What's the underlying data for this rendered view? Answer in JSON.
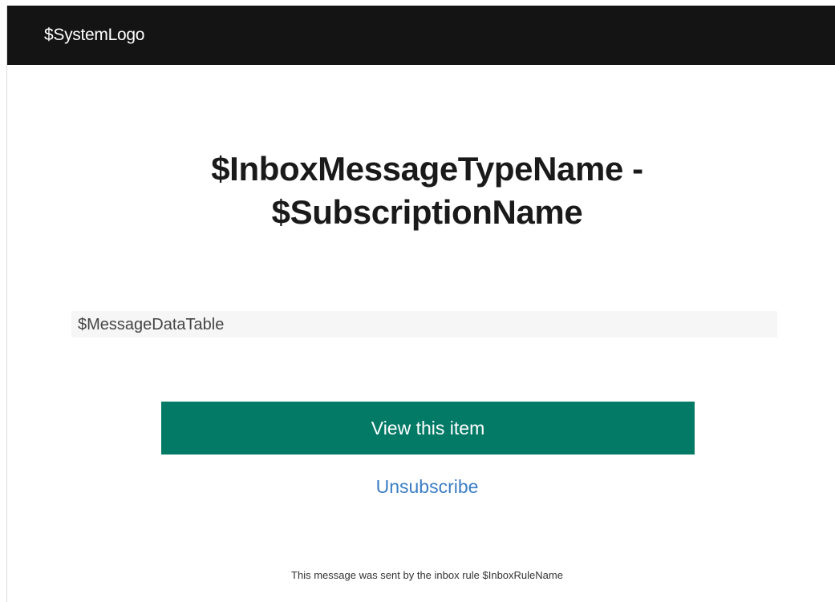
{
  "header": {
    "logo_text": "$SystemLogo"
  },
  "main": {
    "title_line1": "$InboxMessageTypeName -",
    "title_line2": "$SubscriptionName",
    "message_data_table": "$MessageDataTable",
    "view_button_label": "View this item",
    "unsubscribe_label": "Unsubscribe"
  },
  "footer": {
    "text": "This message was sent by the inbox rule $InboxRuleName"
  },
  "colors": {
    "header_bg": "#141414",
    "button_bg": "#037a66",
    "link": "#3b7dc4",
    "table_bg": "#f6f6f6"
  }
}
